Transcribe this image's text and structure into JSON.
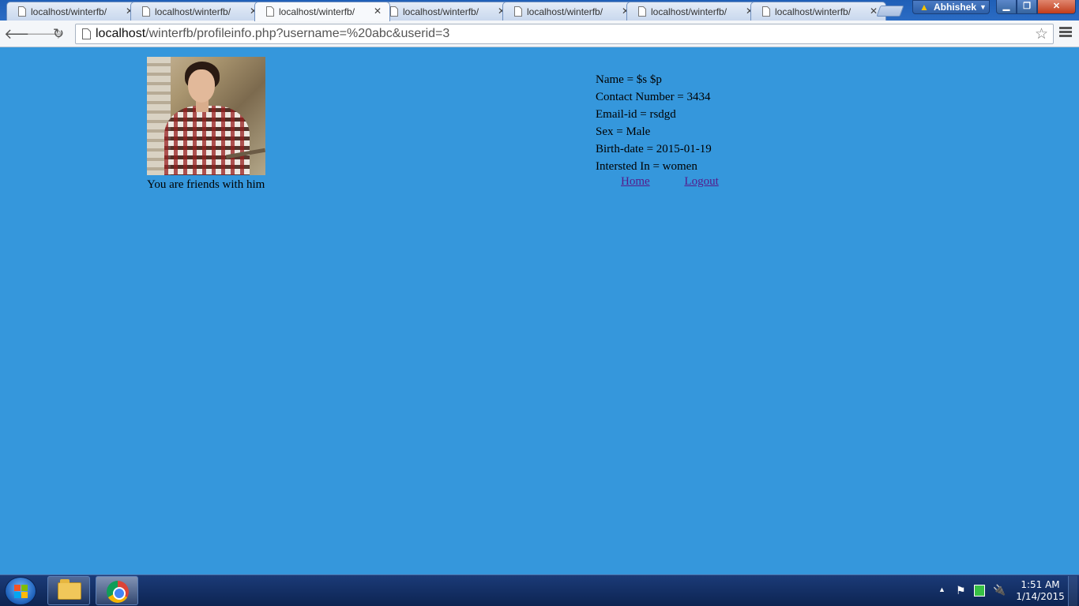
{
  "browser": {
    "tabs": [
      {
        "title": "localhost/winterfb/",
        "active": false
      },
      {
        "title": "localhost/winterfb/",
        "active": false
      },
      {
        "title": "localhost/winterfb/",
        "active": true
      },
      {
        "title": "localhost/winterfb/",
        "active": false
      },
      {
        "title": "localhost/winterfb/",
        "active": false
      },
      {
        "title": "localhost/winterfb/",
        "active": false
      },
      {
        "title": "localhost/winterfb/",
        "active": false
      }
    ],
    "tab_close_glyph": "✕",
    "profile_name": "Abhishek",
    "address": {
      "host": "localhost",
      "path": "/winterfb/profileinfo.php?username=%20abc&userid=3"
    }
  },
  "page": {
    "friend_status": "You are friends with him",
    "info": {
      "name": "Name = $s $p",
      "contact": "Contact Number = 3434",
      "email": "Email-id = rsdgd",
      "sex": "Sex = Male",
      "birth_date": "Birth-date = 2015-01-19",
      "interested_in": "Intersted In = women"
    },
    "links": {
      "home": "Home",
      "logout": "Logout"
    }
  },
  "taskbar": {
    "clock_time": "1:51 AM",
    "clock_date": "1/14/2015"
  },
  "colors": {
    "page_background": "#3597dc",
    "visited_link": "#551a8b",
    "taskbar": "#0d2452"
  },
  "icons": [
    "back-arrow-icon",
    "forward-arrow-icon",
    "reload-icon",
    "page-icon",
    "bookmark-star-icon",
    "menu-icon",
    "windows-start-icon",
    "folder-icon",
    "chrome-icon"
  ]
}
